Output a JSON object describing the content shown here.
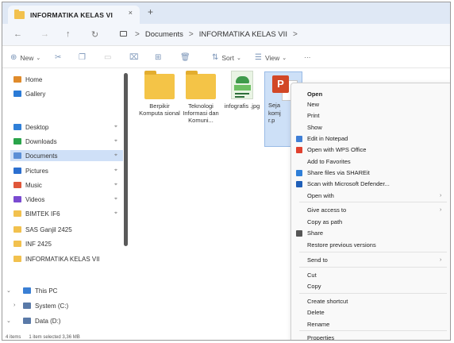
{
  "window": {
    "tab_title": "INFORMATIKA KELAS VI",
    "tab_close": "×",
    "tab_add": "+"
  },
  "address": {
    "back": "←",
    "forward": "→",
    "up": "↑",
    "refresh": "↻",
    "crumbs": [
      "Documents",
      "INFORMATIKA KELAS VII"
    ],
    "sep": ">"
  },
  "toolbar": {
    "new_label": "New",
    "sort_label": "Sort",
    "view_label": "View",
    "more": "···"
  },
  "sidebar": {
    "items": [
      {
        "label": "Home",
        "icon": "home-icon",
        "color": "#e08b2b"
      },
      {
        "label": "Gallery",
        "icon": "gallery-icon",
        "color": "#2b7bd6"
      },
      {
        "label": "Desktop",
        "icon": "desktop-icon",
        "color": "#2f7fd8"
      },
      {
        "label": "Downloads",
        "icon": "download-icon",
        "color": "#2aa44a"
      },
      {
        "label": "Documents",
        "icon": "documents-icon",
        "color": "#5b8fd6"
      },
      {
        "label": "Pictures",
        "icon": "pictures-icon",
        "color": "#2b6fd0"
      },
      {
        "label": "Music",
        "icon": "music-icon",
        "color": "#e0573a"
      },
      {
        "label": "Videos",
        "icon": "videos-icon",
        "color": "#7a4bd1"
      },
      {
        "label": "BIMTEK IF6",
        "icon": "folder-icon",
        "color": "#f2c14e"
      },
      {
        "label": "SAS Ganjil 2425",
        "icon": "folder-icon",
        "color": "#f2c14e"
      },
      {
        "label": "INF 2425",
        "icon": "folder-icon",
        "color": "#f2c14e"
      },
      {
        "label": "INFORMATIKA KELAS VII",
        "icon": "folder-icon",
        "color": "#f2c14e"
      },
      {
        "label": "This PC",
        "icon": "pc-icon",
        "color": "#3a7fd4"
      },
      {
        "label": "System (C:)",
        "icon": "drive-icon",
        "color": "#5a7aa8"
      },
      {
        "label": "Data (D:)",
        "icon": "drive-icon",
        "color": "#5a7aa8"
      }
    ],
    "pin": "📌"
  },
  "files": [
    {
      "name": "Berpikir Komputa sional",
      "type": "folder"
    },
    {
      "name": "Teknologi Informasi dan Komuni...",
      "type": "folder"
    },
    {
      "name": "infografis .jpg",
      "type": "image"
    },
    {
      "name": "Seja komj r.p",
      "type": "pptx"
    }
  ],
  "ppt_letter": "P",
  "context_menu": {
    "items": [
      {
        "label": "Open",
        "bold": true
      },
      {
        "label": "New"
      },
      {
        "label": "Print"
      },
      {
        "label": "Show"
      },
      {
        "label": "Edit in Notepad",
        "icon": "notepad-icon",
        "color": "#3f7fd6"
      },
      {
        "label": "Open with WPS Office",
        "icon": "wps-icon",
        "color": "#e0412f"
      },
      {
        "label": "Add to Favorites"
      },
      {
        "label": "Share files via SHAREit",
        "icon": "shareit-icon",
        "color": "#2f7fd8"
      },
      {
        "label": "Scan with Microsoft Defender...",
        "icon": "defender-icon",
        "color": "#1f5fb8"
      },
      {
        "label": "Open with",
        "chevron": true
      },
      {
        "label": "Give access to",
        "chevron": true
      },
      {
        "label": "Copy as path"
      },
      {
        "label": "Share",
        "icon": "share-icon",
        "color": "#555555"
      },
      {
        "label": "Restore previous versions"
      },
      {
        "label": "Send to",
        "chevron": true
      },
      {
        "label": "Cut"
      },
      {
        "label": "Copy"
      },
      {
        "label": "Create shortcut"
      },
      {
        "label": "Delete"
      },
      {
        "label": "Rename"
      },
      {
        "label": "Properties"
      }
    ],
    "chevron": "›"
  },
  "status": {
    "items": "4 items",
    "selected": "1 item selected  3,36 MB"
  }
}
